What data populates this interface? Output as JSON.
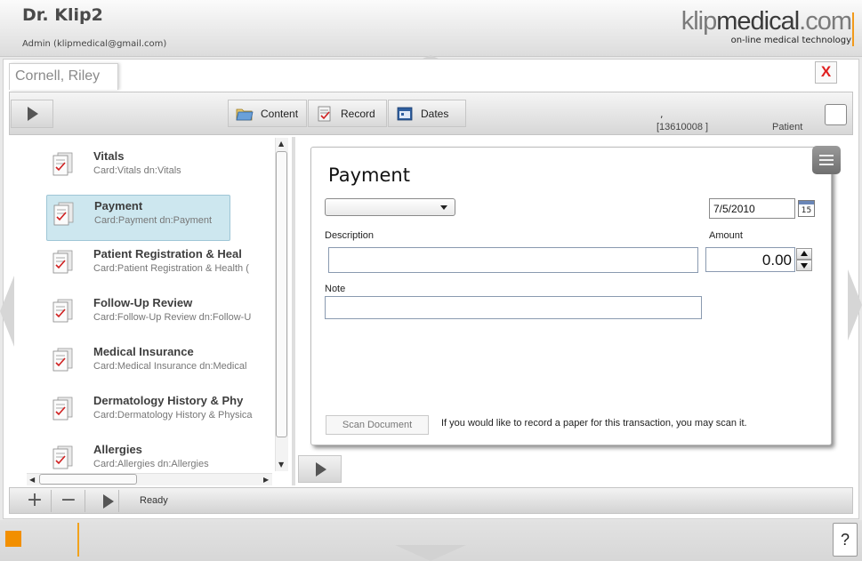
{
  "app": {
    "title": "Dr. Klip2",
    "user": "Admin (klipmedical@gmail.com)",
    "logo": {
      "klip": "klip",
      "medical": "medical",
      "com": ".com",
      "tagline": "on-line medical technology"
    }
  },
  "tab": {
    "patient_name": "Cornell, Riley",
    "close_label": "X"
  },
  "toolbar": {
    "buttons": [
      {
        "label": "Content",
        "icon": "folder-icon"
      },
      {
        "label": "Record",
        "icon": "record-icon"
      },
      {
        "label": "Dates",
        "icon": "calendar-icon"
      }
    ],
    "comma": ",",
    "record_id": "[13610008 ]",
    "patient_label": "Patient"
  },
  "cards": [
    {
      "title": "Vitals",
      "subtitle": "Card:Vitals dn:Vitals",
      "selected": false
    },
    {
      "title": "Payment",
      "subtitle": "Card:Payment dn:Payment",
      "selected": true
    },
    {
      "title": "Patient Registration & Heal",
      "subtitle": "Card:Patient Registration & Health (",
      "selected": false
    },
    {
      "title": "Follow-Up Review",
      "subtitle": "Card:Follow-Up Review dn:Follow-U",
      "selected": false
    },
    {
      "title": "Medical Insurance",
      "subtitle": "Card:Medical Insurance dn:Medical",
      "selected": false
    },
    {
      "title": "Dermatology History & Phy",
      "subtitle": "Card:Dermatology History & Physica",
      "selected": false
    },
    {
      "title": "Allergies",
      "subtitle": "Card:Allergies dn:Allergies",
      "selected": false
    }
  ],
  "form": {
    "title": "Payment",
    "type_select_value": "",
    "date_value": "7/5/2010",
    "calendar_day": "15",
    "description_label": "Description",
    "description_value": "",
    "amount_label": "Amount",
    "amount_value": "0.00",
    "note_label": "Note",
    "note_value": "",
    "scan_button": "Scan Document",
    "scan_hint": "If you would like to record a paper for this transaction, you may scan it."
  },
  "status": {
    "add": "+",
    "remove": "−",
    "text": "Ready"
  },
  "footer": {
    "help": "?"
  },
  "colors": {
    "accent": "#f28f00",
    "close_red": "#e02020",
    "selected_item": "#cde7ef"
  }
}
